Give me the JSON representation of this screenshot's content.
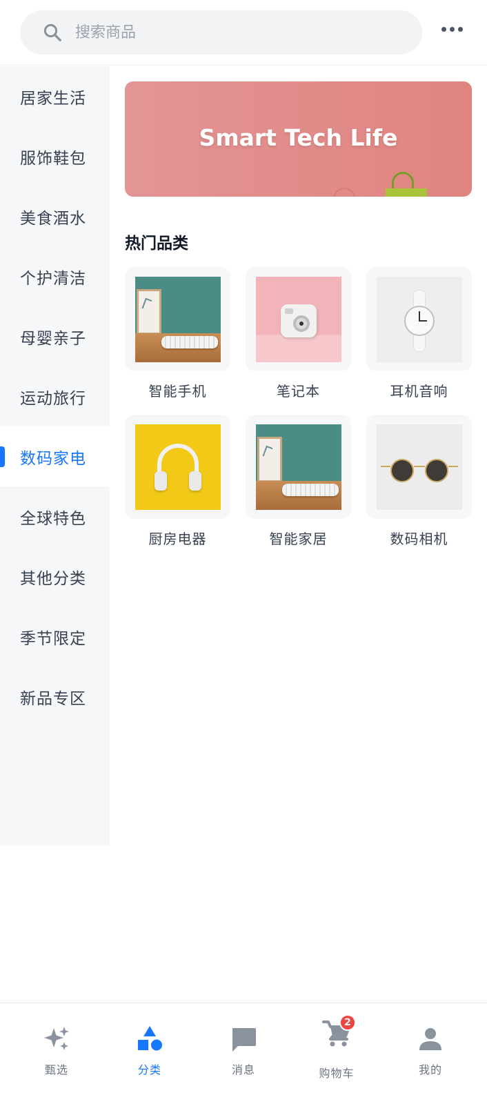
{
  "search": {
    "placeholder": "搜索商品"
  },
  "sidebar": {
    "items": [
      {
        "label": "居家生活",
        "active": false
      },
      {
        "label": "服饰鞋包",
        "active": false
      },
      {
        "label": "美食酒水",
        "active": false
      },
      {
        "label": "个护清洁",
        "active": false
      },
      {
        "label": "母婴亲子",
        "active": false
      },
      {
        "label": "运动旅行",
        "active": false
      },
      {
        "label": "数码家电",
        "active": true
      },
      {
        "label": "全球特色",
        "active": false
      },
      {
        "label": "其他分类",
        "active": false
      },
      {
        "label": "季节限定",
        "active": false
      },
      {
        "label": "新品专区",
        "active": false
      }
    ]
  },
  "banner": {
    "title": "Smart Tech Life"
  },
  "section": {
    "title": "热门品类"
  },
  "categories": [
    {
      "label": "智能手机",
      "image": "speaker-on-desk"
    },
    {
      "label": "笔记本",
      "image": "instant-camera"
    },
    {
      "label": "耳机音响",
      "image": "white-watch"
    },
    {
      "label": "厨房电器",
      "image": "headphones"
    },
    {
      "label": "智能家居",
      "image": "speaker-on-desk"
    },
    {
      "label": "数码相机",
      "image": "sunglasses"
    }
  ],
  "tabbar": {
    "tabs": [
      {
        "label": "甄选",
        "icon": "sparkle-icon"
      },
      {
        "label": "分类",
        "icon": "shapes-icon",
        "active": true
      },
      {
        "label": "消息",
        "icon": "chat-icon"
      },
      {
        "label": "购物车",
        "icon": "cart-icon",
        "badge": "2"
      },
      {
        "label": "我的",
        "icon": "user-icon"
      }
    ]
  },
  "colors": {
    "accent": "#1677ff",
    "badge": "#ef4444",
    "banner": "#e08a86"
  }
}
